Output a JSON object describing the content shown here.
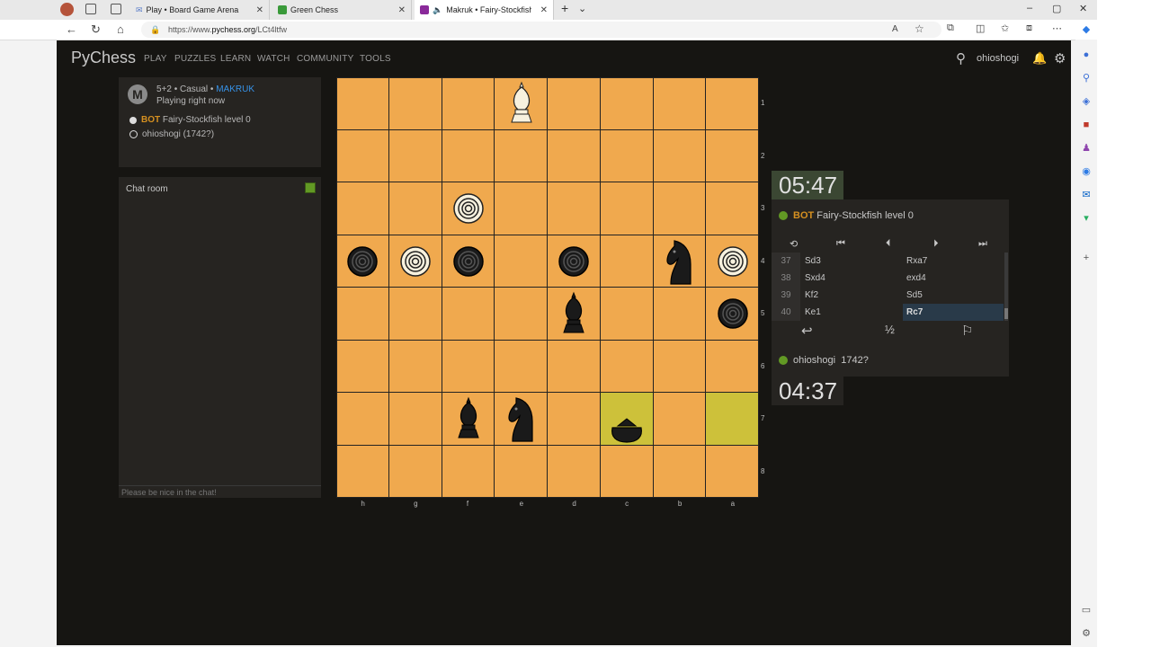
{
  "browser": {
    "tabs": [
      {
        "title": "Play • Board Game Arena"
      },
      {
        "title": "Green Chess"
      },
      {
        "title": "Makruk • Fairy-Stockfish vs"
      }
    ],
    "url_prefix": "https://www.",
    "url_host": "pychess.org",
    "url_path": "/LCt4ltfw"
  },
  "site": {
    "brand": "PyChess",
    "menu": [
      "PLAY",
      "PUZZLES",
      "LEARN",
      "WATCH",
      "COMMUNITY",
      "TOOLS"
    ],
    "username": "ohioshogi"
  },
  "game_info": {
    "time_control": "5+2 • Casual • ",
    "variant": "MAKRUK",
    "status": "Playing right now",
    "white_player_tag": "BOT",
    "white_player_name": "Fairy-Stockfish level 0",
    "black_player": "ohioshogi (1742?)"
  },
  "chat": {
    "title": "Chat room",
    "placeholder": "Please be nice in the chat!"
  },
  "board": {
    "files": [
      "h",
      "g",
      "f",
      "e",
      "d",
      "c",
      "b",
      "a"
    ],
    "ranks": [
      "1",
      "2",
      "3",
      "4",
      "5",
      "6",
      "7",
      "8"
    ],
    "highlight_squares": [
      "c7",
      "a7"
    ],
    "pieces": [
      {
        "square": "e1",
        "type": "khon",
        "color": "white"
      },
      {
        "square": "f3",
        "type": "met",
        "color": "white"
      },
      {
        "square": "h4",
        "type": "met",
        "color": "black"
      },
      {
        "square": "g4",
        "type": "met",
        "color": "white"
      },
      {
        "square": "f4",
        "type": "met",
        "color": "black"
      },
      {
        "square": "d4",
        "type": "met",
        "color": "black"
      },
      {
        "square": "b4",
        "type": "horse",
        "color": "black"
      },
      {
        "square": "a4",
        "type": "met",
        "color": "white"
      },
      {
        "square": "d5",
        "type": "khon",
        "color": "black"
      },
      {
        "square": "a5",
        "type": "met",
        "color": "black"
      },
      {
        "square": "f7",
        "type": "khon",
        "color": "black"
      },
      {
        "square": "e7",
        "type": "horse",
        "color": "black"
      },
      {
        "square": "c7",
        "type": "boat",
        "color": "black"
      }
    ]
  },
  "clocks": {
    "top": "05:47",
    "bottom": "04:37"
  },
  "players_panel": {
    "top_tag": "BOT",
    "top_name": "Fairy-Stockfish level 0",
    "bottom_name": "ohioshogi",
    "bottom_rating": "1742?"
  },
  "moves": [
    {
      "num": "37",
      "white": "Sd3",
      "black": "Rxa7"
    },
    {
      "num": "38",
      "white": "Sxd4",
      "black": "exd4"
    },
    {
      "num": "39",
      "white": "Kf2",
      "black": "Sd5"
    },
    {
      "num": "40",
      "white": "Ke1",
      "black": "Rc7"
    }
  ],
  "actions": {
    "draw_label": "½"
  },
  "colors": {
    "board_light": "#f0a94e",
    "highlight": "#cdc13a",
    "accent_green": "#629924",
    "bot_orange": "#d59020",
    "link_blue": "#3692e7"
  }
}
